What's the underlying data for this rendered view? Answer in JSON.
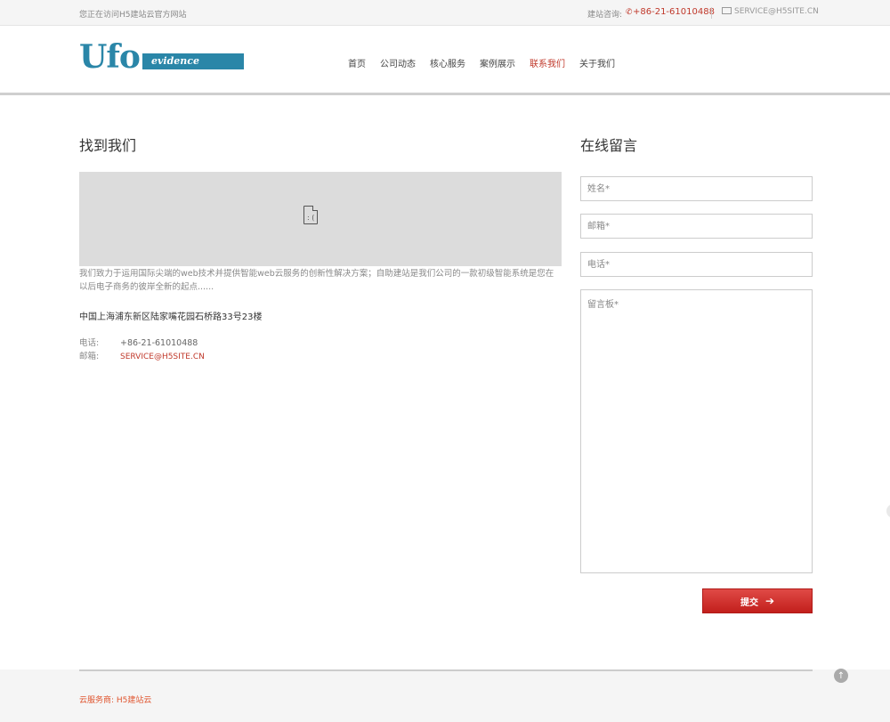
{
  "topbar": {
    "welcome": "您正在访问H5建站云官方网站",
    "consult_label": "建站咨询:",
    "phone": "+86-21-61010488",
    "email": "SERVICE@H5SITE.CN"
  },
  "logo": {
    "big": "Ufo",
    "small": "evidence"
  },
  "nav": [
    {
      "label": "首页",
      "active": false
    },
    {
      "label": "公司动态",
      "active": false
    },
    {
      "label": "核心服务",
      "active": false
    },
    {
      "label": "案例展示",
      "active": false
    },
    {
      "label": "联系我们",
      "active": true
    },
    {
      "label": "关于我们",
      "active": false
    }
  ],
  "left": {
    "title": "找到我们",
    "description": "我们致力于运用国际尖端的web技术并提供智能web云服务的创新性解决方案；自助建站是我们公司的一款初级智能系统是您在以后电子商务的彼岸全新的起点......",
    "address": "中国上海浦东新区陆家嘴花园石桥路33号23楼",
    "phone_label": "电话:",
    "phone_value": "+86-21-61010488",
    "email_label": "邮箱:",
    "email_value": "SERVICE@H5SITE.CN"
  },
  "form": {
    "title": "在线留言",
    "name_placeholder": "姓名*",
    "email_placeholder": "邮箱*",
    "phone_placeholder": "电话*",
    "message_placeholder": "留言板*",
    "submit_label": "提交"
  },
  "footer": {
    "text": "云服务商: H5建站云"
  },
  "icons": {
    "phone": "phone-icon",
    "email": "envelope-icon",
    "map": "broken-image-icon",
    "submit": "arrow-right-icon",
    "totop": "arrow-up-circle-icon"
  },
  "colors": {
    "accent_red": "#c0392b",
    "brand_blue": "#2a86a8",
    "footer_orange": "#e0552f"
  }
}
